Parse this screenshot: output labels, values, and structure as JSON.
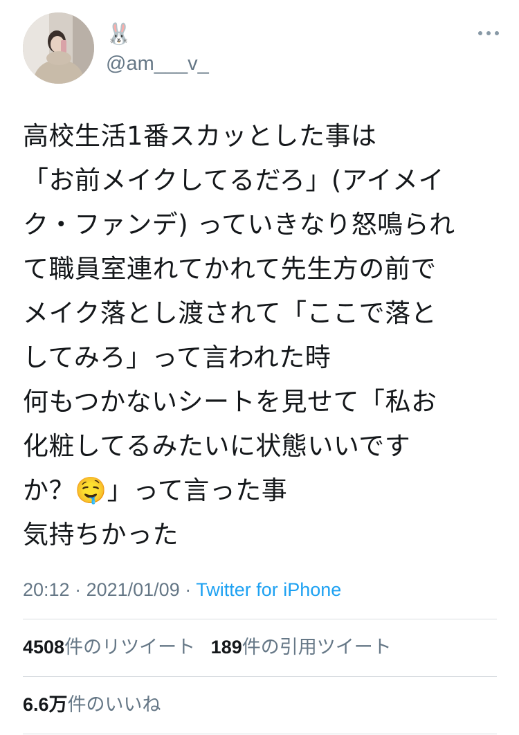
{
  "tweet": {
    "display_name": "🐰",
    "handle": "@am___v_",
    "text": "高校生活1番スカッとした事は\n「お前メイクしてるだろ」(アイメイ\nク・ファンデ) っていきなり怒鳴られ\nて職員室連れてかれて先生方の前で\nメイク落とし渡されて「ここで落と\nしてみろ」って言われた時\n何もつかないシートを見せて「私お\n化粧してるみたいに状態いいです\nか？🤤」って言った事\n気持ちかった",
    "time": "20:12",
    "separator": " · ",
    "date": "2021/01/09",
    "source": "Twitter for iPhone"
  },
  "stats": {
    "retweets": {
      "count": "4508",
      "label": "件のリツイート"
    },
    "quotes": {
      "count": "189",
      "label": "件の引用ツイート"
    },
    "likes": {
      "count": "6.6万",
      "label": "件のいいね"
    }
  },
  "icons": {
    "more": "more-horizontal-icon",
    "avatar": "profile-photo"
  }
}
